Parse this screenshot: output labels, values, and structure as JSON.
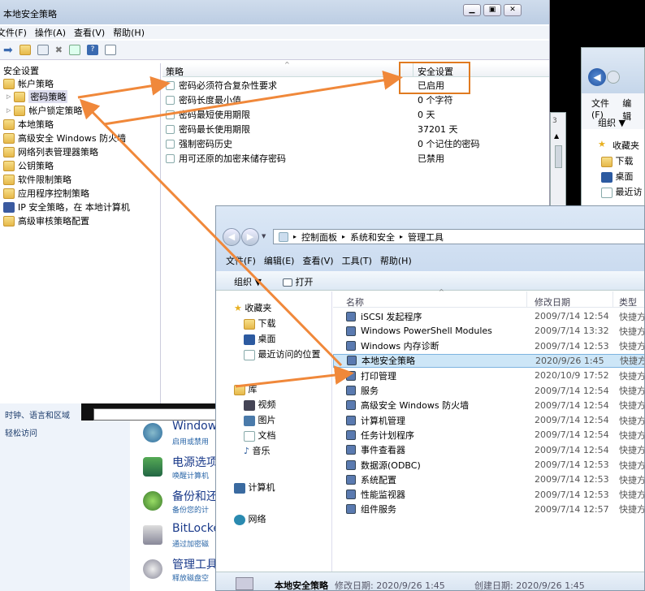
{
  "secpol": {
    "title": "本地安全策略",
    "menu": [
      "文件(F)",
      "操作(A)",
      "查看(V)",
      "帮助(H)"
    ],
    "tree": [
      "安全设置",
      "帐户策略",
      "密码策略",
      "帐户锁定策略",
      "本地策略",
      "高级安全 Windows 防火墙",
      "网络列表管理器策略",
      "公钥策略",
      "软件限制策略",
      "应用程序控制策略",
      "IP 安全策略，在 本地计算机",
      "高级审核策略配置"
    ],
    "col_policy": "策略",
    "col_setting": "安全设置",
    "rows": [
      {
        "p": "密码必须符合复杂性要求",
        "s": "已启用"
      },
      {
        "p": "密码长度最小值",
        "s": "0 个字符"
      },
      {
        "p": "密码最短使用期限",
        "s": "0 天"
      },
      {
        "p": "密码最长使用期限",
        "s": "37201 天"
      },
      {
        "p": "强制密码历史",
        "s": "0 个记住的密码"
      },
      {
        "p": "用可还原的加密来储存密码",
        "s": "已禁用"
      }
    ]
  },
  "bgexp": {
    "menu": [
      "文件(F)",
      "编辑"
    ],
    "org": "组织 ▼",
    "fav": [
      "收藏夹",
      "下载",
      "桌面",
      "最近访"
    ]
  },
  "cp": {
    "left": [
      "时钟、语言和区域",
      "轻松访问"
    ],
    "items": [
      {
        "t": "Window",
        "s": "启用或禁用"
      },
      {
        "t": "电源选项",
        "s": "唤醒计算机"
      },
      {
        "t": "备份和还",
        "s": "备份您的计"
      },
      {
        "t": "BitLocke",
        "s": "通过加密磁"
      },
      {
        "t": "管理工具",
        "s": "释放磁盘空"
      }
    ]
  },
  "admin": {
    "crumbs": [
      "控制面板",
      "系统和安全",
      "管理工具"
    ],
    "menu": [
      "文件(F)",
      "编辑(E)",
      "查看(V)",
      "工具(T)",
      "帮助(H)"
    ],
    "org": "组织 ▼",
    "open": "打开",
    "nav": {
      "fav": "收藏夹",
      "fav_items": [
        "下载",
        "桌面",
        "最近访问的位置"
      ],
      "lib": "库",
      "lib_items": [
        "视频",
        "图片",
        "文档",
        "音乐"
      ],
      "computer": "计算机",
      "network": "网络"
    },
    "cols": [
      "名称",
      "修改日期",
      "类型"
    ],
    "files": [
      {
        "n": "iSCSI 发起程序",
        "d": "2009/7/14 12:54",
        "t": "快捷方"
      },
      {
        "n": "Windows PowerShell Modules",
        "d": "2009/7/14 13:32",
        "t": "快捷方"
      },
      {
        "n": "Windows 内存诊断",
        "d": "2009/7/14 12:53",
        "t": "快捷方"
      },
      {
        "n": "本地安全策略",
        "d": "2020/9/26 1:45",
        "t": "快捷方"
      },
      {
        "n": "打印管理",
        "d": "2020/10/9 17:52",
        "t": "快捷方"
      },
      {
        "n": "服务",
        "d": "2009/7/14 12:54",
        "t": "快捷方"
      },
      {
        "n": "高级安全 Windows 防火墙",
        "d": "2009/7/14 12:54",
        "t": "快捷方"
      },
      {
        "n": "计算机管理",
        "d": "2009/7/14 12:54",
        "t": "快捷方"
      },
      {
        "n": "任务计划程序",
        "d": "2009/7/14 12:54",
        "t": "快捷方"
      },
      {
        "n": "事件查看器",
        "d": "2009/7/14 12:54",
        "t": "快捷方"
      },
      {
        "n": "数据源(ODBC)",
        "d": "2009/7/14 12:53",
        "t": "快捷方"
      },
      {
        "n": "系统配置",
        "d": "2009/7/14 12:53",
        "t": "快捷方"
      },
      {
        "n": "性能监视器",
        "d": "2009/7/14 12:53",
        "t": "快捷方"
      },
      {
        "n": "组件服务",
        "d": "2009/7/14 12:57",
        "t": "快捷方"
      }
    ],
    "status": {
      "name": "本地安全策略",
      "mod": "修改日期: 2020/9/26 1:45",
      "created": "创建日期: 2020/9/26 1:45"
    }
  },
  "colors": {
    "arrow": "#f0883a",
    "highlight": "#e07a20",
    "select": "#cde6f7"
  }
}
